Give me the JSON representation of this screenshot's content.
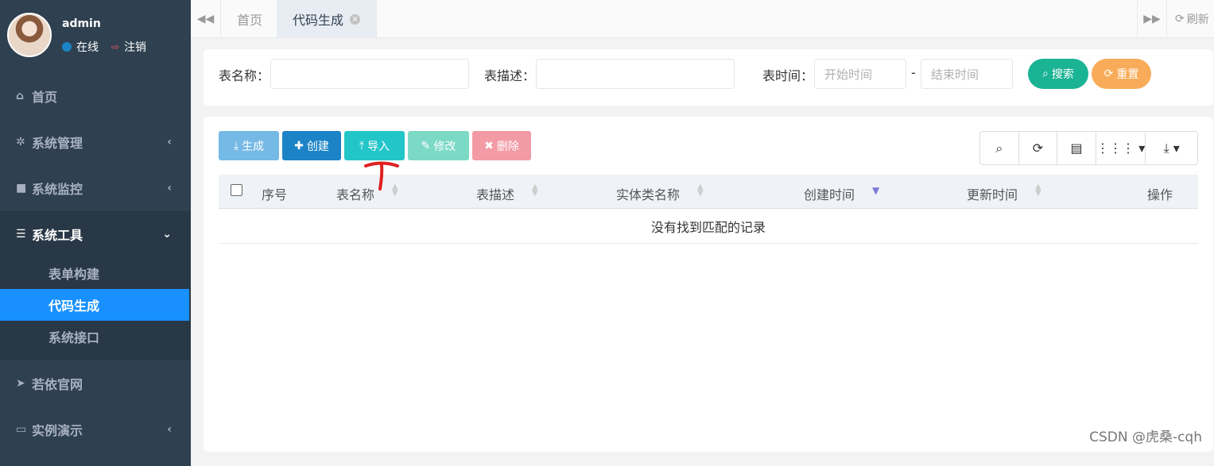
{
  "user": {
    "name": "admin",
    "status": "在线",
    "logout": "注销"
  },
  "menu": {
    "home": "首页",
    "system_manage": "系统管理",
    "system_monitor": "系统监控",
    "system_tools": "系统工具",
    "tools_sub": [
      "表单构建",
      "代码生成",
      "系统接口"
    ],
    "ruoyi_site": "若依官网",
    "demo": "实例演示"
  },
  "tabs": {
    "home": "首页",
    "current": "代码生成",
    "refresh": "刷新"
  },
  "search": {
    "table_name_label": "表名称：",
    "table_desc_label": "表描述：",
    "table_time_label": "表时间：",
    "start_placeholder": "开始时间",
    "end_placeholder": "结束时间",
    "dash": "-",
    "search_btn": "搜索",
    "reset_btn": "重置"
  },
  "toolbar": {
    "generate": "生成",
    "create": "创建",
    "import": "导入",
    "edit": "修改",
    "delete": "删除"
  },
  "table": {
    "columns": [
      "序号",
      "表名称",
      "表描述",
      "实体类名称",
      "创建时间",
      "更新时间",
      "操作"
    ],
    "empty": "没有找到匹配的记录"
  },
  "watermark": "CSDN @虎桑-cqh",
  "colors": {
    "sidebar": "#2f4050",
    "active": "#1890ff",
    "search": "#1ab394",
    "reset": "#f8ac59",
    "import": "#23c6c8",
    "arrow": "#e02020"
  }
}
